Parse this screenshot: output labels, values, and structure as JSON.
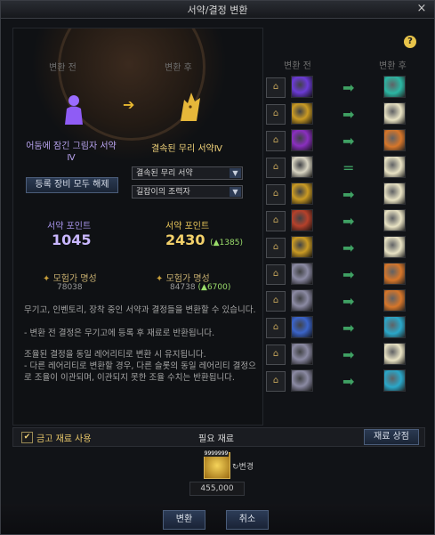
{
  "window": {
    "title": "서약/결정 변환",
    "close_icon": "×"
  },
  "left": {
    "before_label": "변환 전",
    "after_label": "변환 후",
    "item_before": "어둠에 잠긴 그림자 서약Ⅳ",
    "item_after": "결속된 무리 서약Ⅳ",
    "register_all_button": "등록 장비 모두 해제",
    "select_1": "결속된 무리 서약",
    "select_2": "길잡이의 조력자",
    "point_label_before": "서약 포인트",
    "point_before": "1045",
    "point_label_after": "서약 포인트",
    "point_after": "2430",
    "point_gain": "(▲1385)",
    "fame_label_before": "모험가 명성",
    "fame_before": "78038",
    "fame_label_after": "모험가 명성",
    "fame_after": "84738",
    "fame_gain": "(▲6700)",
    "desc_1": "무기고, 인벤토리, 장착 중인 서약과 결정들을 변환할 수 있습니다.",
    "desc_2": "- 변환 전 결정은 무기고에 등록 후 재료로 반환됩니다.",
    "desc_3": "조율된 결정을 동일 레어리티로 변환 시 유지됩니다.",
    "desc_4": "- 다른 레어리티로 변환할 경우, 다른 슬롯의 동일 레어리티 결정으로 조율이 이관되며, 이관되지 못한 조율 수치는 반환됩니다."
  },
  "right": {
    "before_label": "변환 전",
    "after_label": "변환 후",
    "rows": [
      {
        "before": "#6b3bd6",
        "after": "#2bb6a3",
        "arrow": "➡"
      },
      {
        "before": "#c99a24",
        "after": "#e9e3c4",
        "arrow": "➡"
      },
      {
        "before": "#8a2fbf",
        "after": "#d6762a",
        "arrow": "➡"
      },
      {
        "before": "#d8d4c2",
        "after": "#e9e3c4",
        "arrow": "="
      },
      {
        "before": "#c99a24",
        "after": "#e9e3c4",
        "arrow": "➡"
      },
      {
        "before": "#b5412b",
        "after": "#e9e3c4",
        "arrow": "➡"
      },
      {
        "before": "#c99a24",
        "after": "#e9e3c4",
        "arrow": "➡"
      },
      {
        "before": "#8b8aa3",
        "after": "#d6762a",
        "arrow": "➡"
      },
      {
        "before": "#8b8aa3",
        "after": "#d6762a",
        "arrow": "➡"
      },
      {
        "before": "#3b64c9",
        "after": "#2aa7c9",
        "arrow": "➡"
      },
      {
        "before": "#8b8aa3",
        "after": "#e9e3c4",
        "arrow": "➡"
      },
      {
        "before": "#8b8aa3",
        "after": "#2aa7c9",
        "arrow": "➡"
      }
    ]
  },
  "bottom": {
    "use_gold_label": "금고 재료 사용",
    "required_label": "필요 재료",
    "material_shop_button": "재료 상점",
    "material_qty": "9999999",
    "change_label": "↻변경",
    "price": "455,000"
  },
  "footer": {
    "convert_button": "변환",
    "cancel_button": "취소"
  }
}
